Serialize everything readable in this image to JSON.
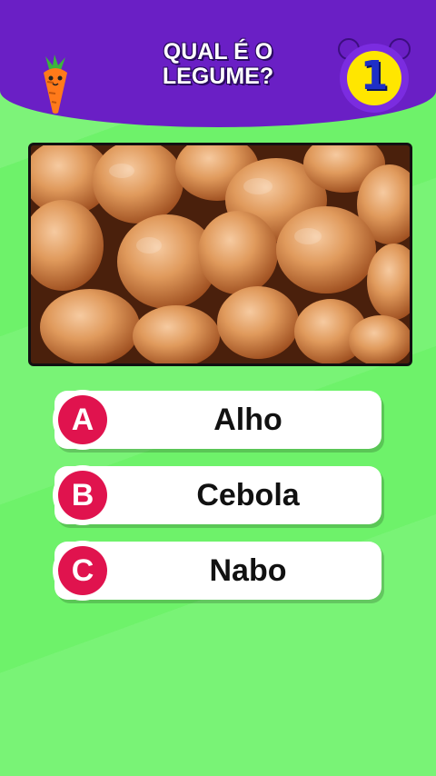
{
  "header": {
    "title": "QUAL É O\nLEGUME?",
    "timer_value": "1",
    "mascot_icon": "carrot-icon",
    "timer_icon": "alarm-clock-icon",
    "color": "#6a1fc5"
  },
  "image": {
    "subject_icon": "onions-photo"
  },
  "answers": [
    {
      "letter": "A",
      "text": "Alho"
    },
    {
      "letter": "B",
      "text": "Cebola"
    },
    {
      "letter": "C",
      "text": "Nabo"
    }
  ],
  "colors": {
    "accent": "#e0134e",
    "background": "#6ef26a",
    "timer_face": "#ffe600"
  }
}
